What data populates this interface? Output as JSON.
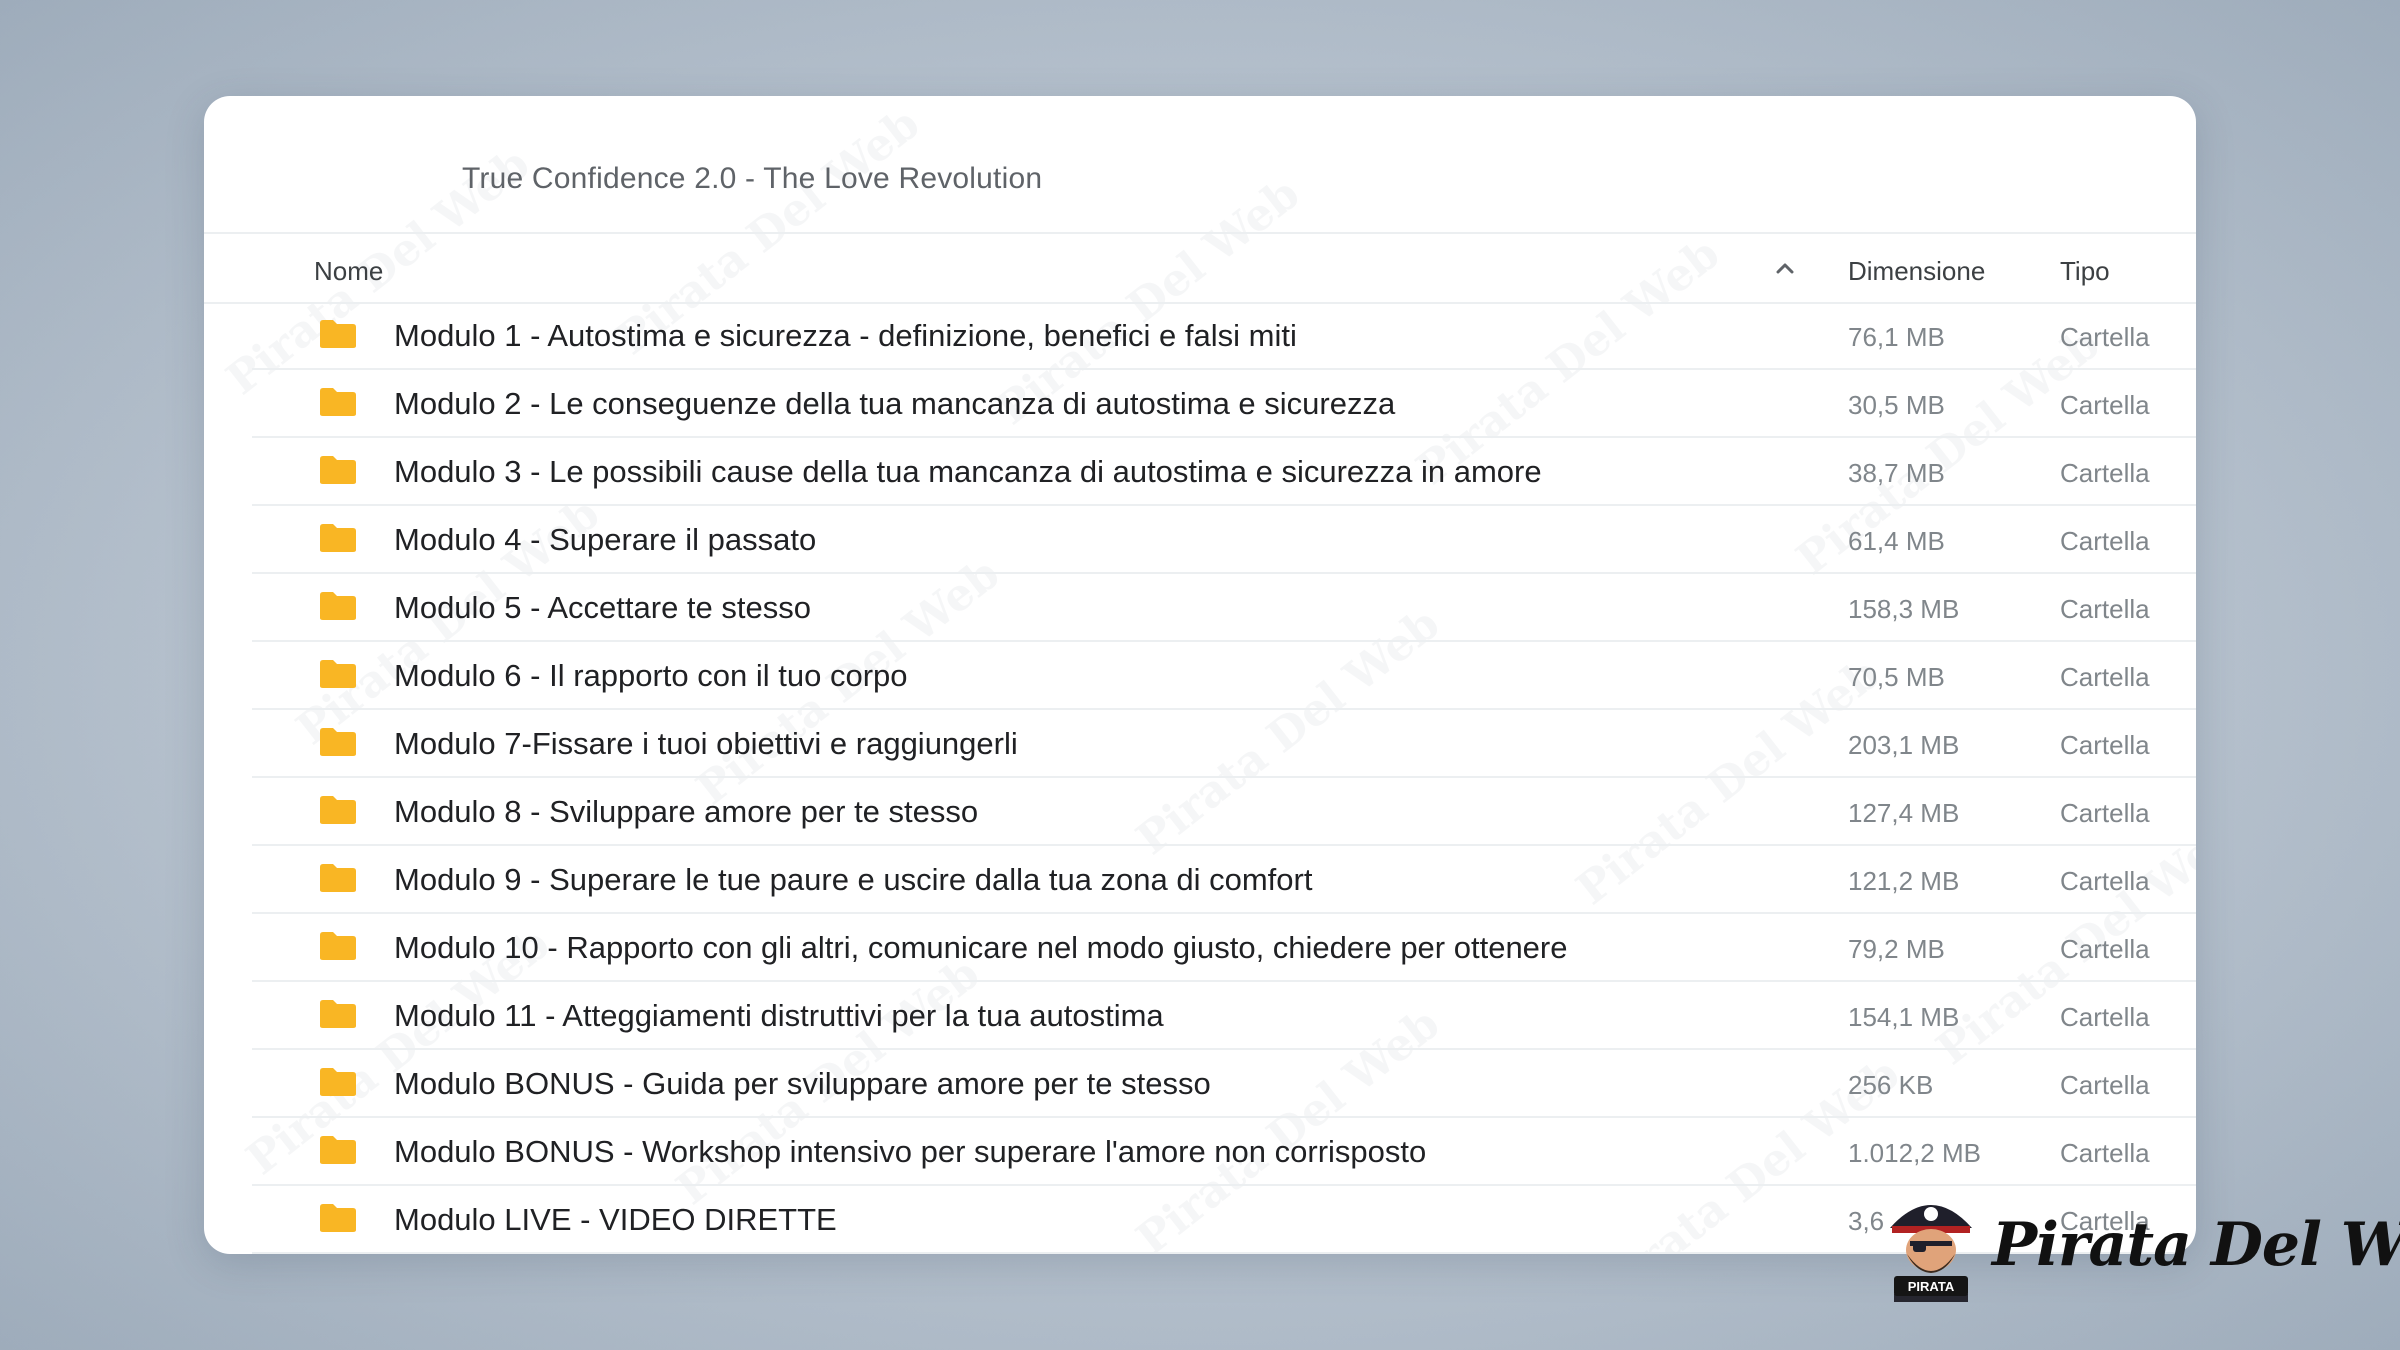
{
  "folder": {
    "title": "True Confidence 2.0 - The Love Revolution"
  },
  "columns": {
    "name": "Nome",
    "size": "Dimensione",
    "type": "Tipo"
  },
  "rows": [
    {
      "name": "Modulo 1 - Autostima e sicurezza - definizione, benefici e falsi miti",
      "size": "76,1 MB",
      "type": "Cartella"
    },
    {
      "name": "Modulo 2 - Le conseguenze della tua mancanza di autostima e sicurezza",
      "size": "30,5 MB",
      "type": "Cartella"
    },
    {
      "name": "Modulo 3 - Le possibili cause della tua mancanza di autostima e sicurezza in amore",
      "size": "38,7 MB",
      "type": "Cartella"
    },
    {
      "name": "Modulo 4 - Superare il passato",
      "size": "61,4 MB",
      "type": "Cartella"
    },
    {
      "name": "Modulo 5 - Accettare te stesso",
      "size": "158,3 MB",
      "type": "Cartella"
    },
    {
      "name": "Modulo 6 - Il rapporto con il tuo corpo",
      "size": "70,5 MB",
      "type": "Cartella"
    },
    {
      "name": "Modulo 7-Fissare i tuoi obiettivi e raggiungerli",
      "size": "203,1 MB",
      "type": "Cartella"
    },
    {
      "name": "Modulo 8 - Sviluppare amore per te stesso",
      "size": "127,4 MB",
      "type": "Cartella"
    },
    {
      "name": "Modulo 9 - Superare le tue paure e uscire dalla tua zona di comfort",
      "size": "121,2 MB",
      "type": "Cartella"
    },
    {
      "name": "Modulo 10 - Rapporto con gli altri, comunicare nel modo giusto, chiedere per ottenere",
      "size": "79,2 MB",
      "type": "Cartella"
    },
    {
      "name": "Modulo 11 - Atteggiamenti distruttivi per la tua autostima",
      "size": "154,1 MB",
      "type": "Cartella"
    },
    {
      "name": "Modulo BONUS - Guida per sviluppare amore per te stesso",
      "size": "256 KB",
      "type": "Cartella"
    },
    {
      "name": "Modulo BONUS - Workshop intensivo per superare l'amore non corrisposto",
      "size": "1.012,2 MB",
      "type": "Cartella"
    },
    {
      "name": "Modulo LIVE - VIDEO DIRETTE",
      "size": "3,6",
      "type": "Cartella"
    }
  ],
  "icons": {
    "folder": "folder-icon",
    "sort": "chevron-up-icon"
  },
  "colors": {
    "folder": "#F9B624",
    "text_primary": "#202124",
    "text_secondary": "#80868b"
  },
  "brand": {
    "name": "Pirata Del Web",
    "badge": "PIRATA"
  },
  "watermark": "Pirata Del Web"
}
